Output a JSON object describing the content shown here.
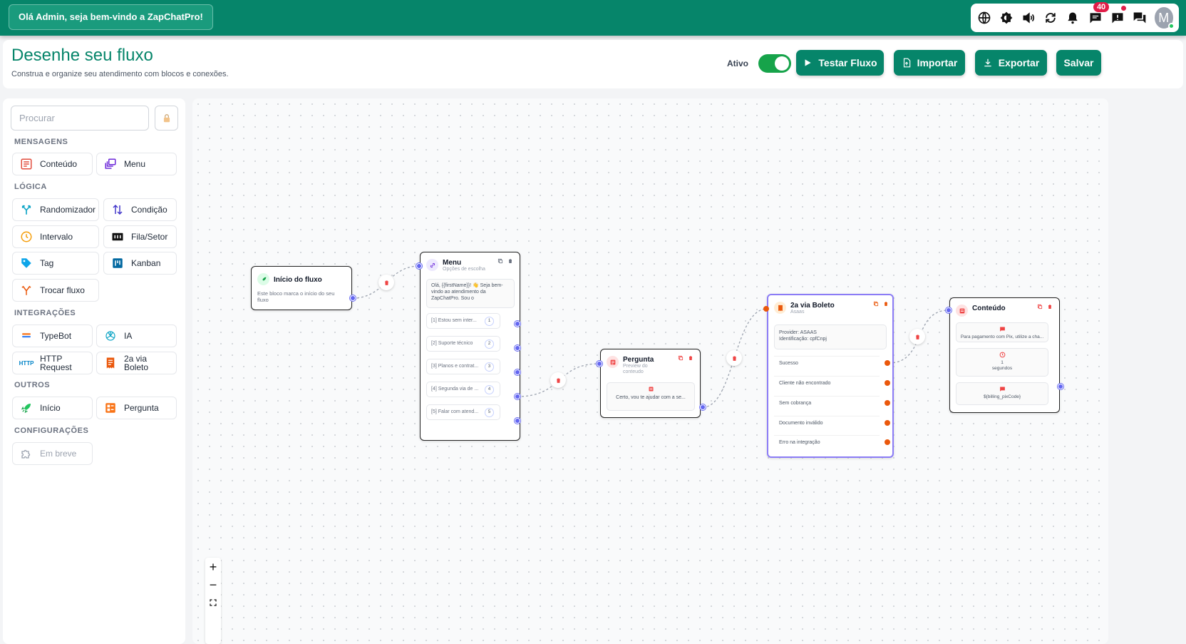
{
  "topbar": {
    "greeting": "Olá Admin, seja bem-vindo a ZapChatPro!",
    "badge_count": "40",
    "avatar_initial": "M",
    "icons": [
      "globe-icon",
      "contrast-icon",
      "volume-icon",
      "refresh-icon",
      "bell-icon",
      "chat-icon",
      "alert-icon",
      "chats-icon"
    ]
  },
  "header": {
    "title": "Desenhe seu fluxo",
    "subtitle": "Construa e organize seu atendimento com blocos e conexões.",
    "active_label": "Ativo",
    "active": true,
    "test_label": "Testar Fluxo",
    "import_label": "Importar",
    "export_label": "Exportar",
    "save_label": "Salvar"
  },
  "sidebar": {
    "search_placeholder": "Procurar",
    "sections": {
      "messages": "MENSAGENS",
      "logic": "LÓGICA",
      "integrations": "INTEGRAÇÕES",
      "others": "OUTROS",
      "settings": "CONFIGURAÇÕES"
    },
    "blocks": {
      "conteudo": "Conteúdo",
      "menu": "Menu",
      "randomizador": "Randomizador",
      "condicao": "Condição",
      "intervalo": "Intervalo",
      "fila": "Fila/Setor",
      "tag": "Tag",
      "kanban": "Kanban",
      "trocar": "Trocar fluxo",
      "typebot": "TypeBot",
      "ia": "IA",
      "http1": "HTTP",
      "http2": "Request",
      "http_icon": "HTTP",
      "boleto1": "2a via",
      "boleto2": "Boleto",
      "inicio": "Início",
      "pergunta": "Pergunta",
      "embreve": "Em breve"
    }
  },
  "nodes": {
    "start": {
      "title": "Início do fluxo",
      "text": "Este bloco marca o início do seu fluxo"
    },
    "menu": {
      "title": "Menu",
      "subtitle": "Opções de escolha",
      "message": "Olá, {{firstName}}! 👋 Seja bem-vindo ao atendimento da ZapChatPro. Sou o",
      "options": [
        {
          "label": "[1] Estou sem inter...",
          "num": "1"
        },
        {
          "label": "[2] Suporte técnico",
          "num": "2"
        },
        {
          "label": "[3] Planos e contrat...",
          "num": "3"
        },
        {
          "label": "[4] Segunda via de ...",
          "num": "4"
        },
        {
          "label": "[5] Falar com atend...",
          "num": "5"
        }
      ]
    },
    "pergunta": {
      "title": "Pergunta",
      "subtitle1": "Preview do",
      "subtitle2": "conteudo",
      "text": "Certo, vou te ajudar com a se..."
    },
    "boleto": {
      "title": "2a via Boleto",
      "subtitle": "Asaas",
      "provider": "Provider: ASAAS",
      "ident": "Identificação: cpfCnpj",
      "outputs": [
        "Sucesso",
        "Cliente não encontrado",
        "Sem cobrança",
        "Documento inválido",
        "Erro na integração"
      ]
    },
    "conteudo": {
      "title": "Conteúdo",
      "item1": "Para pagamento com Pix, utilize a cha...",
      "interval_value": "1",
      "interval_unit": "segundos",
      "item3": "${billing_pixCode}"
    }
  },
  "zoom": {
    "plus": "+",
    "minus": "−"
  }
}
